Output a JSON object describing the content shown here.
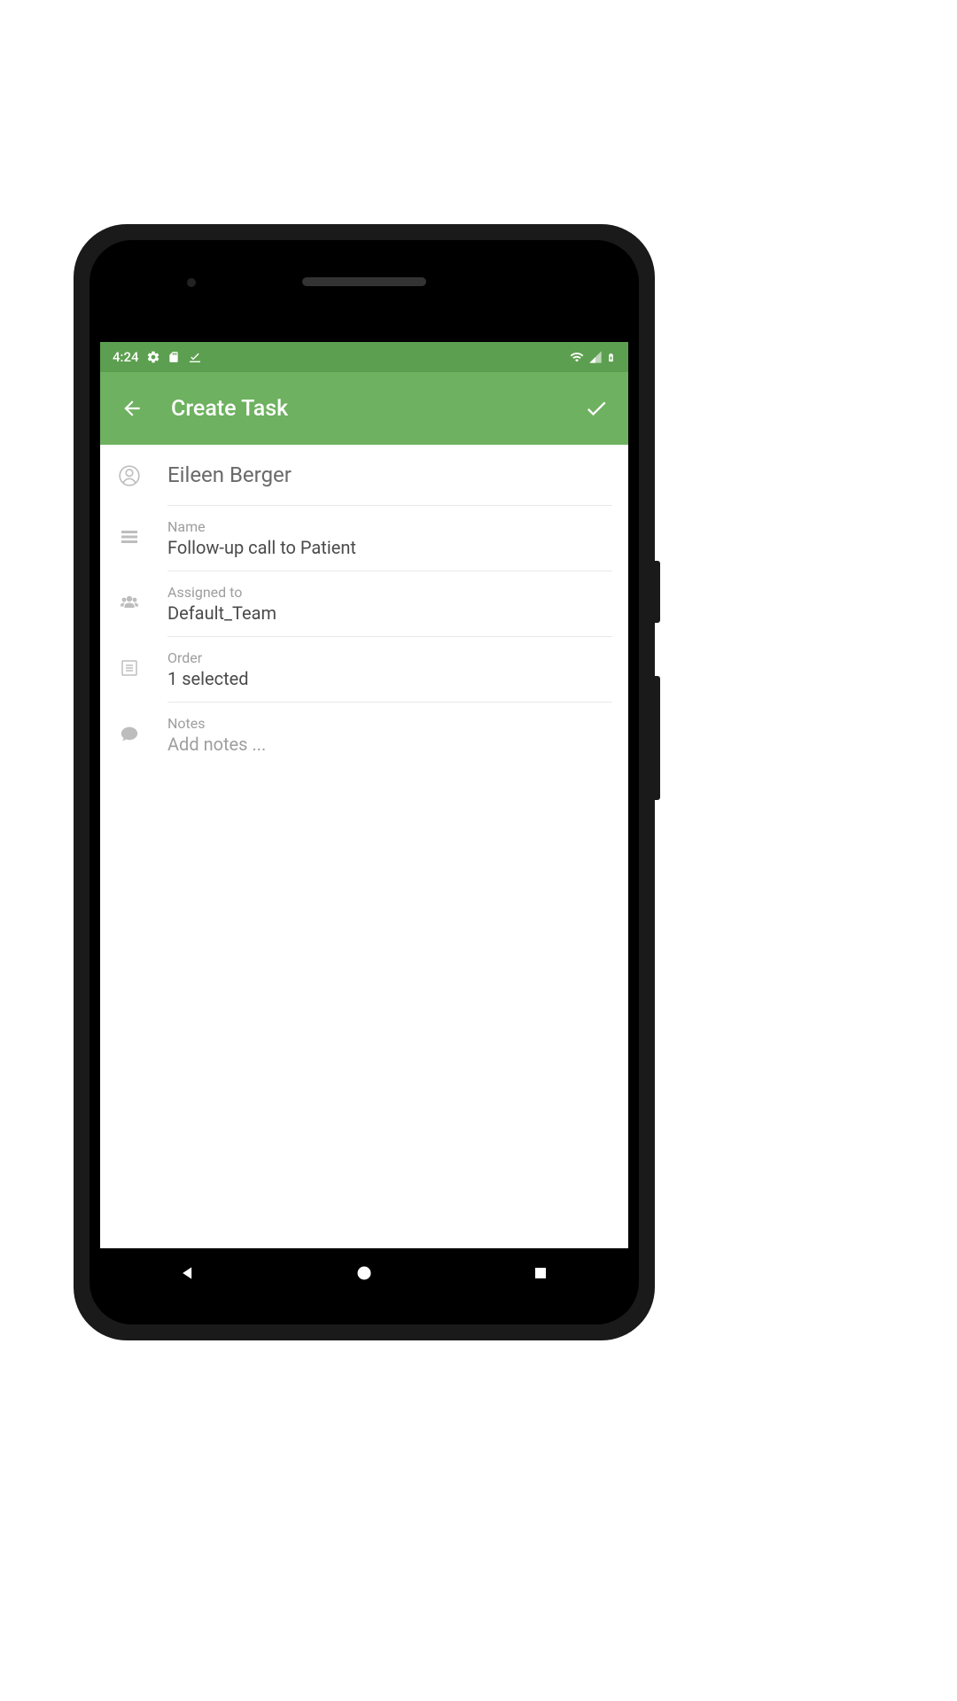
{
  "status_bar": {
    "time": "4:24",
    "icons": {
      "settings": "gear",
      "sd": "sd-card",
      "check": "check-underline",
      "wifi": "wifi",
      "signal": "signal",
      "battery": "battery-charging"
    }
  },
  "app_bar": {
    "title": "Create Task"
  },
  "patient": {
    "name": "Eileen Berger"
  },
  "fields": {
    "name": {
      "label": "Name",
      "value": "Follow-up call to Patient"
    },
    "assigned_to": {
      "label": "Assigned to",
      "value": "Default_Team"
    },
    "order": {
      "label": "Order",
      "value": "1 selected"
    },
    "notes": {
      "label": "Notes",
      "placeholder": "Add notes ..."
    }
  },
  "colors": {
    "primary": "#6eb160",
    "primary_dark": "#5d9f50"
  }
}
